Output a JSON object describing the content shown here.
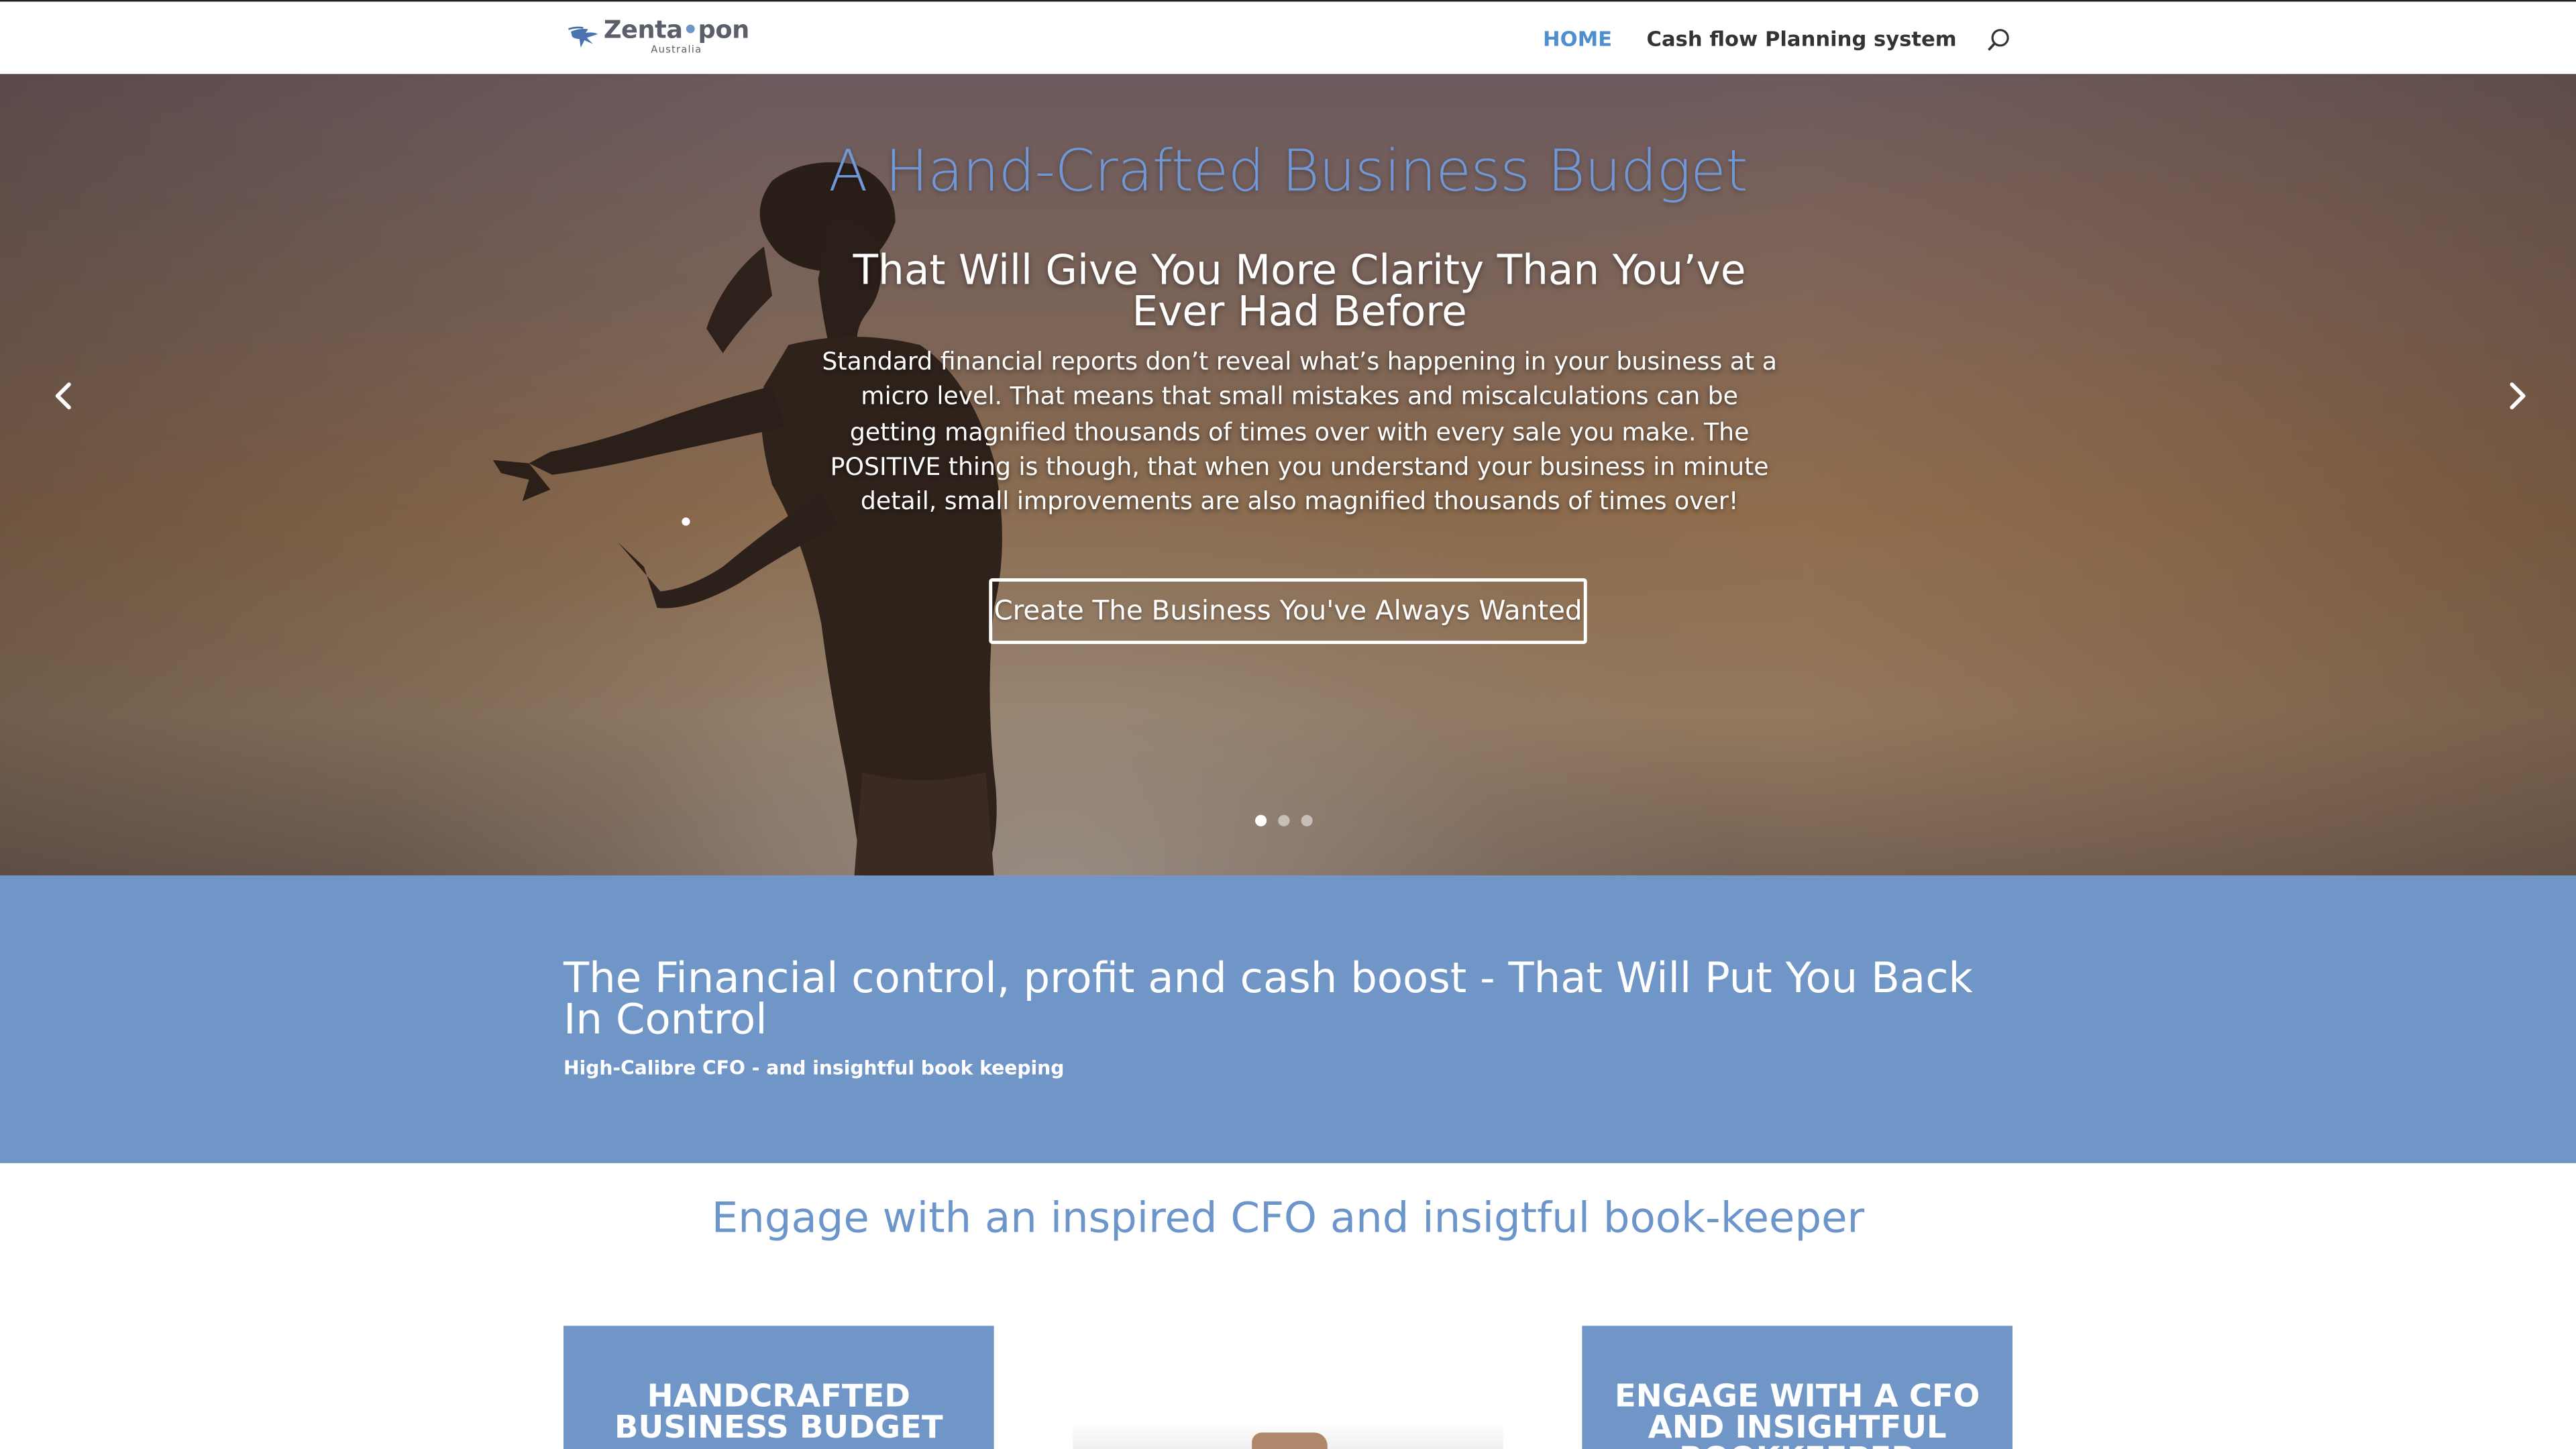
{
  "header": {
    "logo": {
      "name_part1": "Zenta",
      "name_dot": "•",
      "name_part2": "pon",
      "sub": "Australia"
    },
    "nav": [
      {
        "label": "HOME",
        "active": true
      },
      {
        "label": "Cash flow Planning system",
        "active": false
      }
    ],
    "search_icon": "search-icon"
  },
  "hero": {
    "title": "A Hand-Crafted Business Budget",
    "subtitle": "That Will Give You More Clarity Than You’ve Ever Had Before",
    "body": "Standard financial reports don’t reveal what’s happening in your business at a micro level. That means that small mistakes and miscalculations can be getting magnified thousands of times over with every sale you make. The POSITIVE thing is though, that when you understand your business in minute detail, small improvements are also magnified thousands of times over!",
    "button_label": "Create The Business You've Always Wanted",
    "slides_count": 3,
    "active_slide": 1,
    "prev_icon": "chevron-left-icon",
    "next_icon": "chevron-right-icon"
  },
  "band": {
    "title": "The Financial control, profit and cash boost - That Will Put You Back In Control",
    "subtitle": "High-Calibre CFO - and insightful book keeping"
  },
  "section": {
    "title": "Engage with an inspired CFO and insigtful book-keeper",
    "cards": [
      {
        "title": "HANDCRAFTED BUSINESS BUDGET"
      },
      {
        "title": ""
      },
      {
        "title": "ENGAGE WITH A CFO AND INSIGHTFUL BOOKKEEPER"
      }
    ]
  },
  "colors": {
    "brand_blue": "#7096c7",
    "nav_active": "#4e8fd0",
    "hero_title": "#7098d6",
    "text_dark": "#333333"
  }
}
